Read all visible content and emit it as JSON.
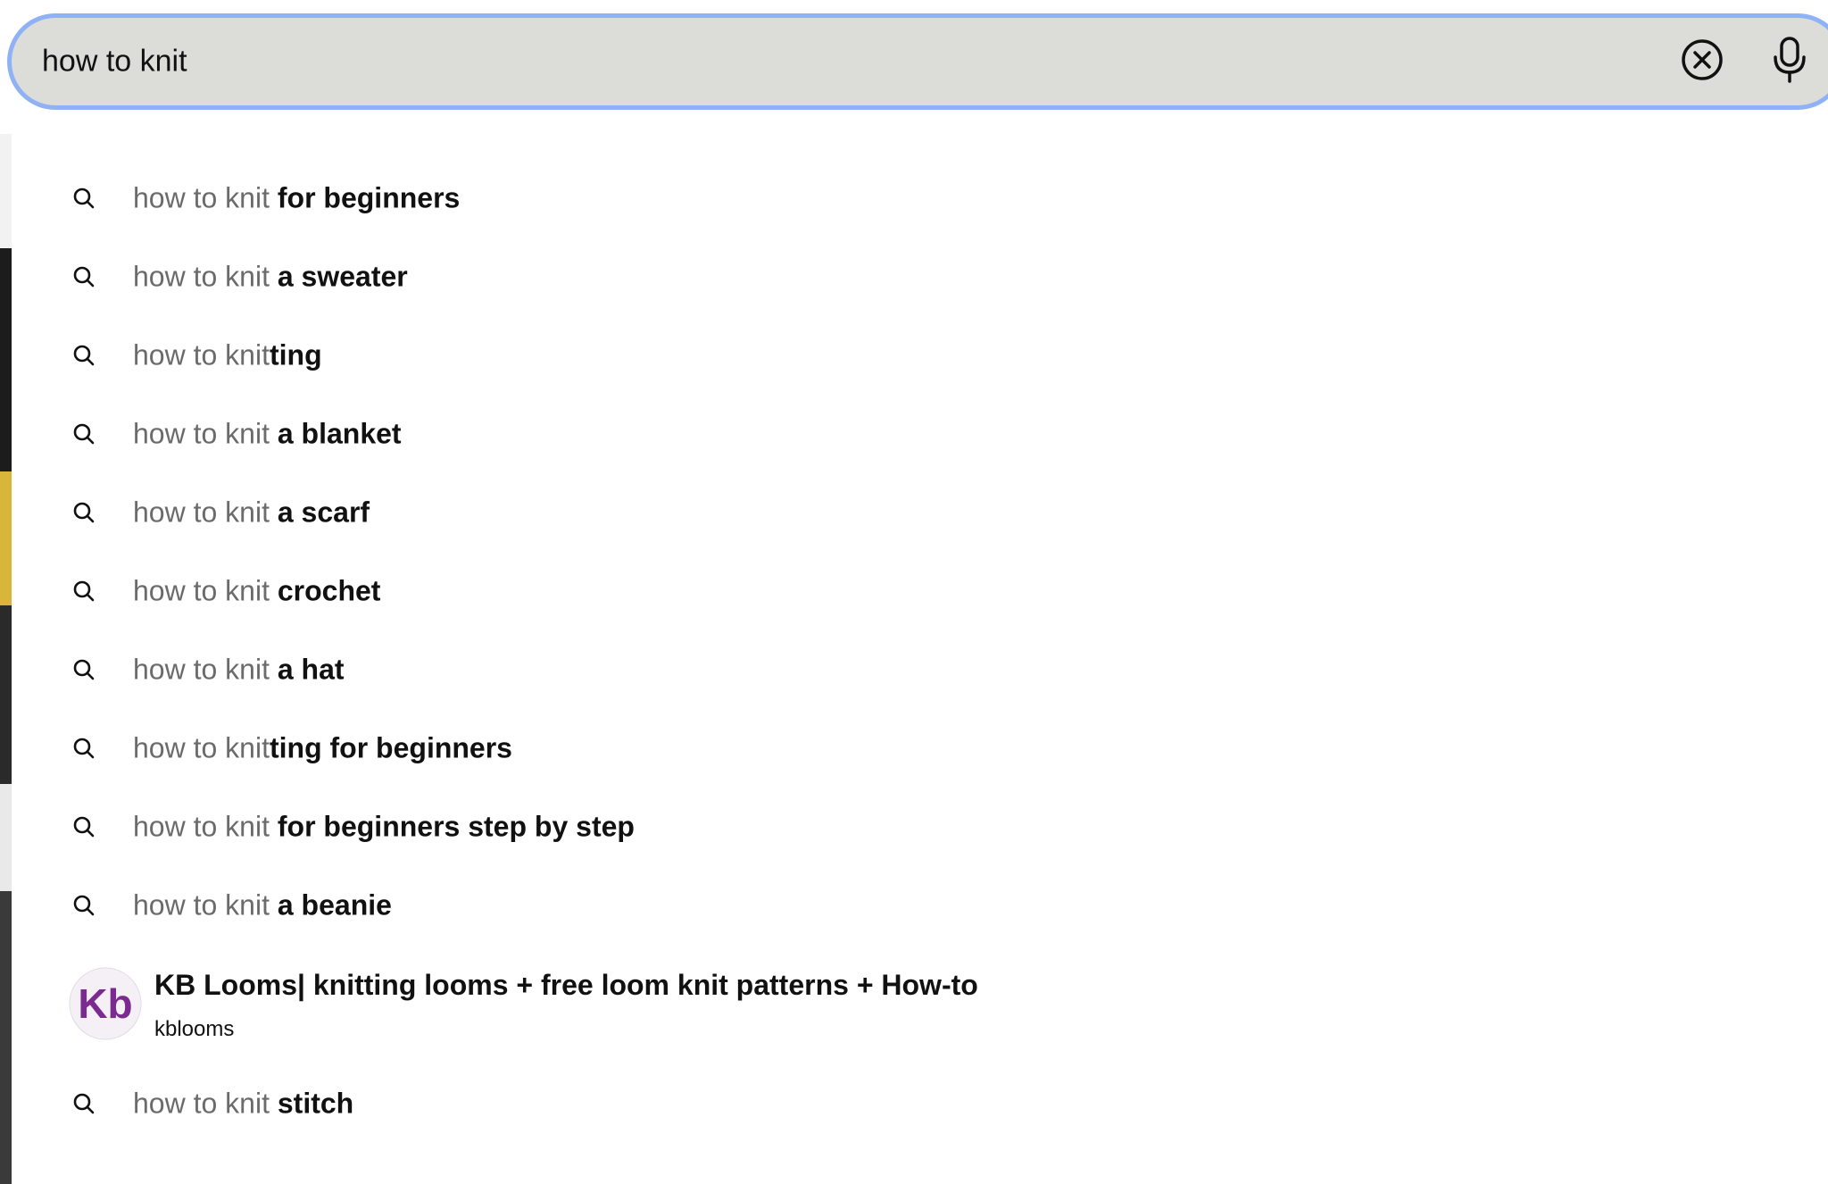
{
  "search": {
    "query": "how to knit"
  },
  "suggestions": [
    {
      "typed": "how to knit",
      "completion": " for beginners"
    },
    {
      "typed": "how to knit",
      "completion": " a sweater"
    },
    {
      "typed": "how to knit",
      "completion": "ting"
    },
    {
      "typed": "how to knit",
      "completion": " a blanket"
    },
    {
      "typed": "how to knit",
      "completion": " a scarf"
    },
    {
      "typed": "how to knit",
      "completion": " crochet"
    },
    {
      "typed": "how to knit",
      "completion": " a hat"
    },
    {
      "typed": "how to knit",
      "completion": "ting for beginners"
    },
    {
      "typed": "how to knit",
      "completion": " for beginners step by step"
    },
    {
      "typed": "how to knit",
      "completion": " a beanie"
    },
    {
      "typed": "how to knit",
      "completion": " stitch"
    }
  ],
  "profile": {
    "title": "KB Looms| knitting looms + free loom knit patterns + How-to",
    "username": "kblooms",
    "avatar_text": "Kb",
    "avatar_color": "#7b2b8f"
  },
  "colors": {
    "search_bg": "#dcdcd8",
    "focus_ring": "#8fb2f4",
    "typed_text": "#6b6b6b",
    "completion_text": "#111111"
  },
  "icons": {
    "clear": "x-circle-icon",
    "mic": "microphone-icon",
    "suggestion": "search-icon"
  }
}
